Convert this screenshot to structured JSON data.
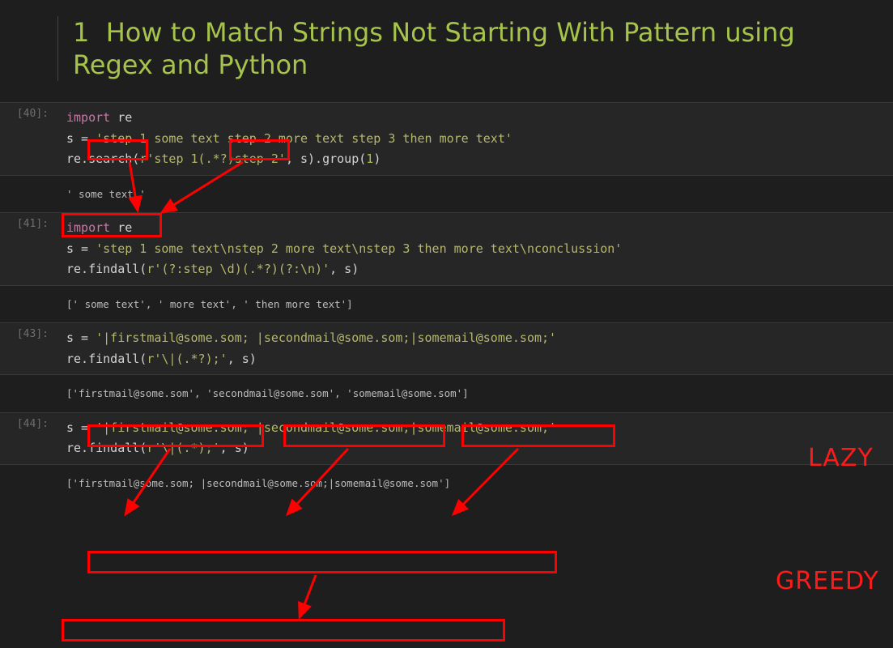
{
  "heading": {
    "number": "1",
    "title": "How to Match Strings Not Starting With Pattern using Regex and Python"
  },
  "cells": [
    {
      "prompt": "[40]:",
      "code": {
        "line1_import": "import",
        "line1_mod": " re",
        "line2_pre": "s = ",
        "line2_str": "'step 1 some text step 2 more text step 3 then more text'",
        "line3_pre": "re.search(",
        "line3_str": "r'step 1(.*?)step 2'",
        "line3_mid": ", s).group(",
        "line3_num": "1",
        "line3_end": ")"
      },
      "output": "' some text '"
    },
    {
      "prompt": "[41]:",
      "code": {
        "line1_import": "import",
        "line1_mod": " re",
        "line2_pre": "s = ",
        "line2_str": "'step 1 some text\\nstep 2 more text\\nstep 3 then more text\\nconclussion'",
        "line3_pre": "re.findall(",
        "line3_str": "r'(?:step \\d)(.*?)(?:\\n)'",
        "line3_mid": ", s)",
        "line3_num": "",
        "line3_end": ""
      },
      "output": "[' some text', ' more text', ' then more text']"
    },
    {
      "prompt": "[43]:",
      "code": {
        "line1_import": "",
        "line1_mod": "",
        "line2_pre": "s = ",
        "line2_str": "'|firstmail@some.som; |secondmail@some.som;|somemail@some.som;'",
        "line3_pre": "re.findall(",
        "line3_str": "r'\\|(.*?);'",
        "line3_mid": ", s)",
        "line3_num": "",
        "line3_end": ""
      },
      "output": "['firstmail@some.som', 'secondmail@some.som', 'somemail@some.som']"
    },
    {
      "prompt": "[44]:",
      "code": {
        "line1_import": "",
        "line1_mod": "",
        "line2_pre": "s = ",
        "line2_str": "'|firstmail@some.som; |secondmail@some.som;|somemail@some.som;'",
        "line3_pre": "re.findall(",
        "line3_str": "r'\\|(.*);'",
        "line3_mid": ", s)",
        "line3_num": "",
        "line3_end": ""
      },
      "output": "['firstmail@some.som; |secondmail@some.som;|somemail@some.som']"
    }
  ],
  "annotations": {
    "lazy": "LAZY",
    "greedy": "GREEDY"
  }
}
